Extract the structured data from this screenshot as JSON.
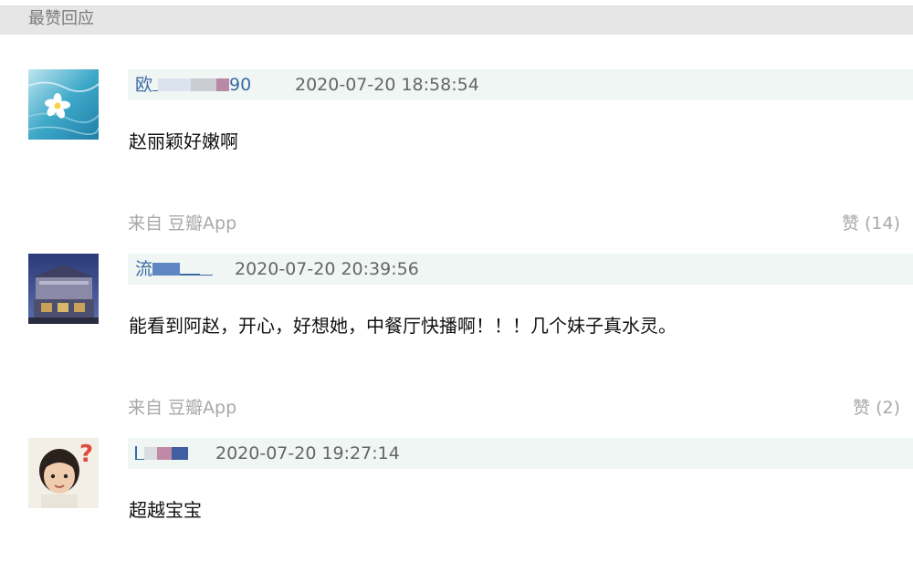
{
  "section": {
    "title": "最赞回应"
  },
  "comments": [
    {
      "author": "欧  90",
      "author_prefix": "欧",
      "author_suffix": "90",
      "timestamp": "2020-07-20 18:58:54",
      "text": "赵丽颖好嫩啊",
      "source": "来自 豆瓣App",
      "like_label": "赞 (14)",
      "avatar": "flower-on-water-avatar"
    },
    {
      "author": "流  ",
      "author_prefix": "流",
      "author_suffix": "",
      "timestamp": "2020-07-20 20:39:56",
      "text": "能看到阿赵，开心，好想她，中餐厅快播啊！！！几个妹子真水灵。",
      "source": "来自 豆瓣App",
      "like_label": "赞 (2)",
      "avatar": "house-at-dusk-avatar"
    },
    {
      "author": "",
      "author_prefix": "",
      "author_suffix": "",
      "timestamp": "2020-07-20 19:27:14",
      "text": "超越宝宝",
      "source": "",
      "like_label": "",
      "avatar": "child-with-question-mark-avatar"
    }
  ],
  "colors": {
    "author": "#3a6aa5",
    "meta_bar": "#f0f6f3",
    "muted": "#a8a8a8",
    "header_bg": "#e6e6e6"
  }
}
